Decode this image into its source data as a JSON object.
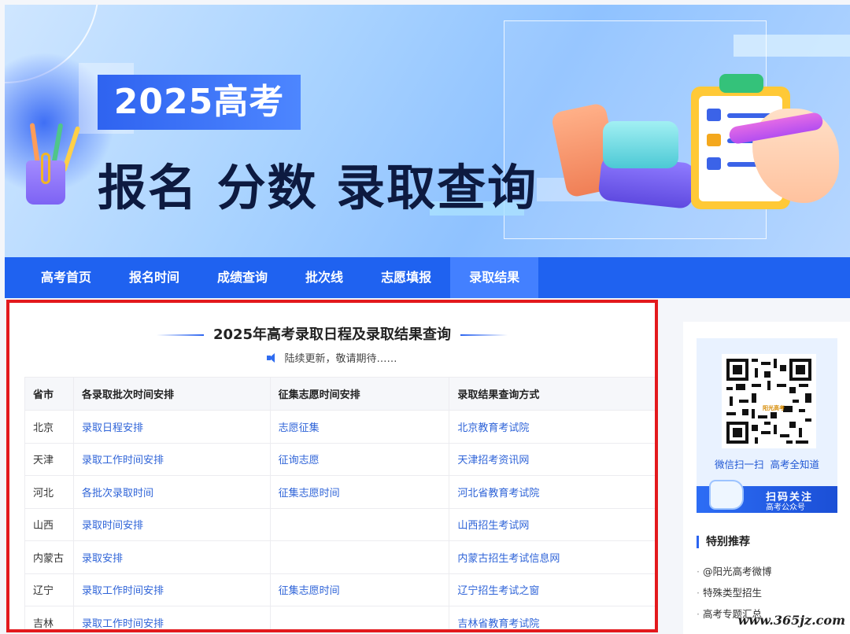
{
  "banner": {
    "year_title": "2025高考",
    "headline": "报名 分数 录取查询"
  },
  "nav": {
    "items": [
      {
        "label": "高考首页"
      },
      {
        "label": "报名时间"
      },
      {
        "label": "成绩查询"
      },
      {
        "label": "批次线"
      },
      {
        "label": "志愿填报"
      },
      {
        "label": "录取结果",
        "active": true
      }
    ]
  },
  "main": {
    "title": "2025年高考录取日程及录取结果查询",
    "notice": "陆续更新，敬请期待……",
    "table": {
      "headers": [
        "省市",
        "各录取批次时间安排",
        "征集志愿时间安排",
        "录取结果查询方式"
      ],
      "rows": [
        [
          "北京",
          "录取日程安排",
          "志愿征集",
          "北京教育考试院"
        ],
        [
          "天津",
          "录取工作时间安排",
          "征询志愿",
          "天津招考资讯网"
        ],
        [
          "河北",
          "各批次录取时间",
          "征集志愿时间",
          "河北省教育考试院"
        ],
        [
          "山西",
          "录取时间安排",
          "",
          "山西招生考试网"
        ],
        [
          "内蒙古",
          "录取安排",
          "",
          "内蒙古招生考试信息网"
        ],
        [
          "辽宁",
          "录取工作时间安排",
          "征集志愿时间",
          "辽宁招生考试之窗"
        ],
        [
          "吉林",
          "录取工作时间安排",
          "",
          "吉林省教育考试院"
        ]
      ]
    }
  },
  "sidebar": {
    "qr_logo": "阳光高考",
    "qr_caption": "微信扫一扫  高考全知道",
    "qr_banner_line1": "扫码关注",
    "qr_banner_line2": "高考公众号",
    "recommend_title": "特别推荐",
    "recommend_items": [
      "@阳光高考微博",
      "特殊类型招生",
      "高考专题汇总"
    ]
  },
  "watermark": "www.365jz.com",
  "colors": {
    "nav_bg": "#1f62f0",
    "nav_active": "#4380ff",
    "link": "#2f64d8",
    "highlight_border": "#e3191d"
  }
}
